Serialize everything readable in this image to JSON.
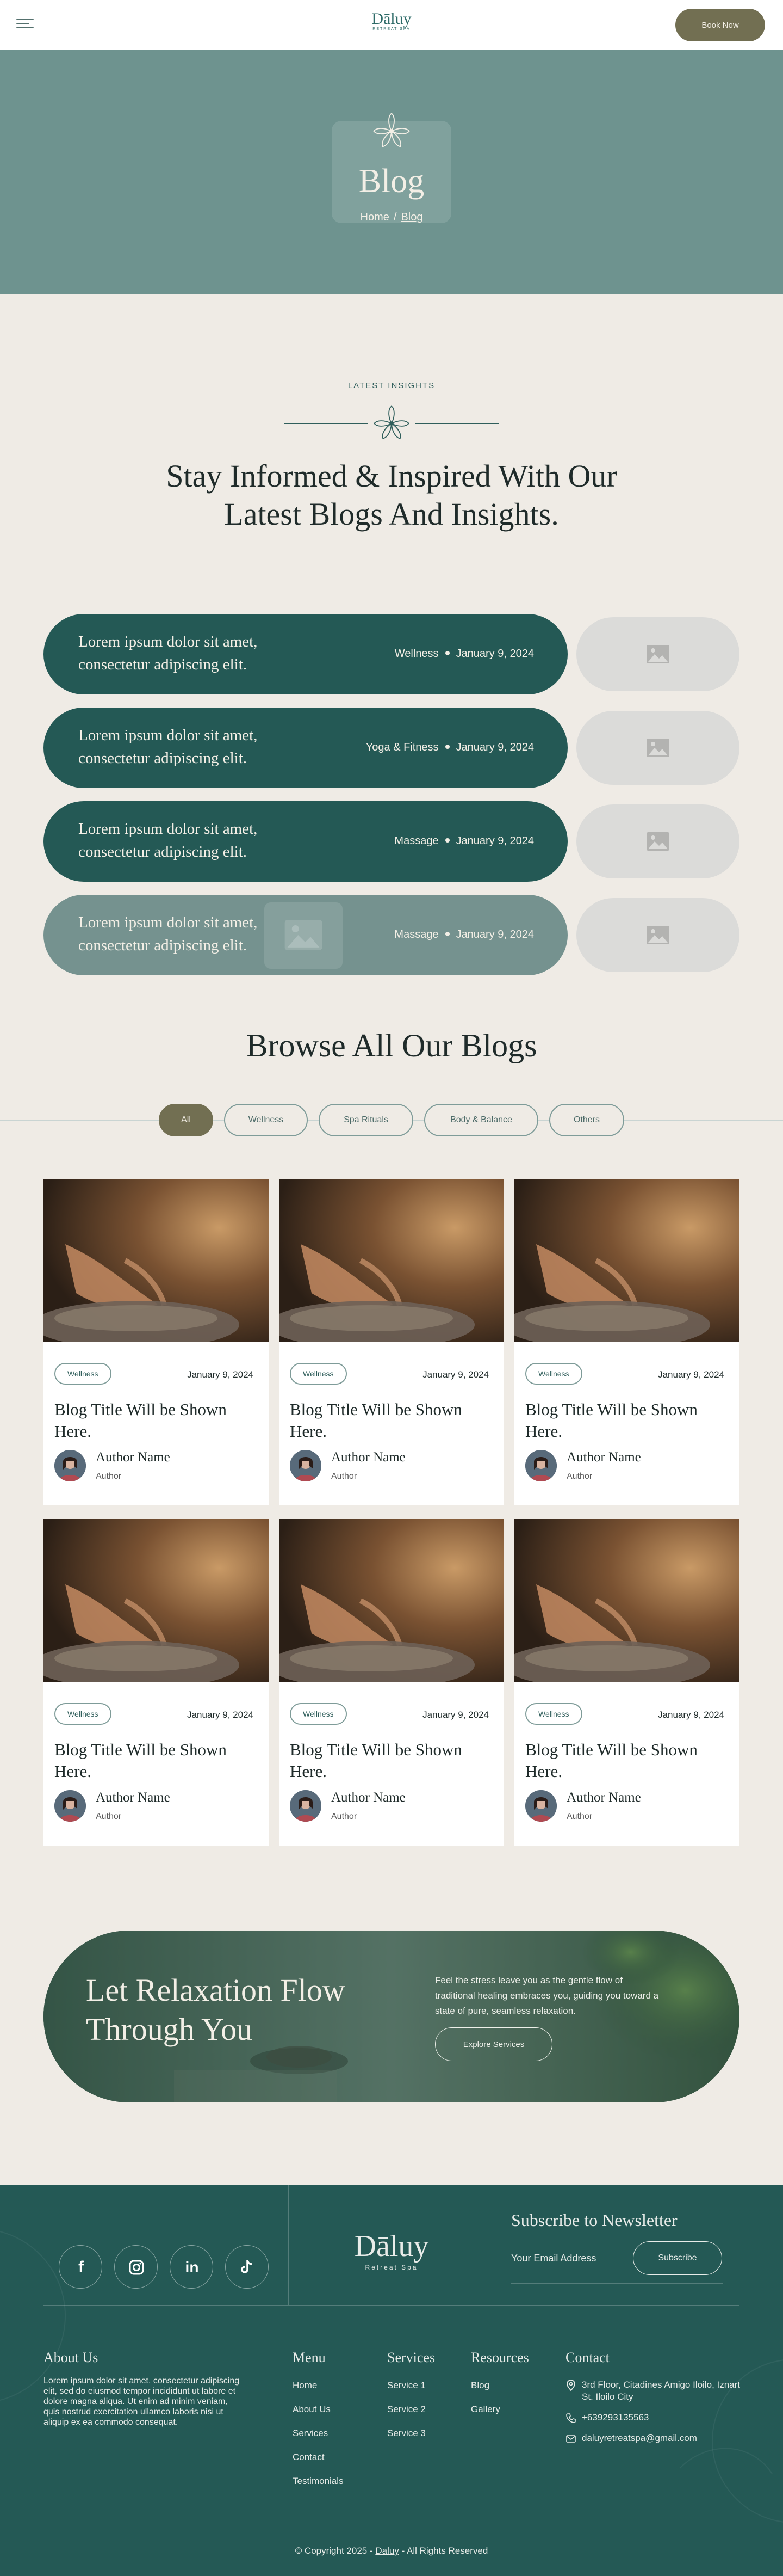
{
  "header": {
    "logo_name": "Dāluy",
    "logo_sub": "RETREAT SPA",
    "book_label": "Book Now"
  },
  "hero": {
    "title": "Blog",
    "crumb_home": "Home",
    "crumb_sep": "/",
    "crumb_current": "Blog"
  },
  "latest": {
    "eyebrow": "LATEST INSIGHTS",
    "title_line1": "Stay Informed & Inspired With Our",
    "title_line2": "Latest Blogs And Insights.",
    "items": [
      {
        "title": "Lorem ipsum dolor sit amet, consectetur adipiscing elit.",
        "category": "Wellness",
        "date": "January 9, 2024"
      },
      {
        "title": "Lorem ipsum dolor sit amet, consectetur adipiscing elit.",
        "category": "Yoga & Fitness",
        "date": "January 9, 2024"
      },
      {
        "title": "Lorem ipsum dolor sit amet, consectetur adipiscing elit.",
        "category": "Massage",
        "date": "January 9, 2024"
      },
      {
        "title": "Lorem ipsum dolor sit amet, consectetur adipiscing elit.",
        "category": "Massage",
        "date": "January 9, 2024"
      }
    ]
  },
  "browse": {
    "title": "Browse All Our Blogs",
    "filters": [
      "All",
      "Wellness",
      "Spa Rituals",
      "Body & Balance",
      "Others"
    ],
    "active_filter": "All",
    "cards": [
      {
        "tag": "Wellness",
        "date": "January 9, 2024",
        "title": "Blog Title Will be Shown Here.",
        "author": "Author Name",
        "role": "Author"
      },
      {
        "tag": "Wellness",
        "date": "January 9, 2024",
        "title": "Blog Title Will be Shown Here.",
        "author": "Author Name",
        "role": "Author"
      },
      {
        "tag": "Wellness",
        "date": "January 9, 2024",
        "title": "Blog Title Will be Shown Here.",
        "author": "Author Name",
        "role": "Author"
      },
      {
        "tag": "Wellness",
        "date": "January 9, 2024",
        "title": "Blog Title Will be Shown Here.",
        "author": "Author Name",
        "role": "Author"
      },
      {
        "tag": "Wellness",
        "date": "January 9, 2024",
        "title": "Blog Title Will be Shown Here.",
        "author": "Author Name",
        "role": "Author"
      },
      {
        "tag": "Wellness",
        "date": "January 9, 2024",
        "title": "Blog Title Will be Shown Here.",
        "author": "Author Name",
        "role": "Author"
      }
    ]
  },
  "cta": {
    "title_line1": "Let Relaxation Flow",
    "title_line2": "Through You",
    "text": "Feel the stress leave you as the gentle flow of traditional healing embraces you, guiding you toward a state of pure, seamless relaxation.",
    "button": "Explore Services"
  },
  "footer": {
    "social": [
      "facebook-icon",
      "instagram-icon",
      "linkedin-icon",
      "tiktok-icon"
    ],
    "logo_name": "Dāluy",
    "logo_sub": "Retreat Spa",
    "newsletter_title": "Subscribe to Newsletter",
    "newsletter_placeholder": "Your Email Address",
    "subscribe_label": "Subscribe",
    "about_title": "About Us",
    "about_text": "Lorem ipsum dolor sit amet, consectetur adipiscing elit, sed do eiusmod tempor incididunt ut labore et dolore magna aliqua. Ut enim ad minim veniam, quis nostrud exercitation ullamco laboris nisi ut aliquip ex ea commodo consequat.",
    "menu_title": "Menu",
    "menu": [
      "Home",
      "About Us",
      "Services",
      "Contact",
      "Testimonials"
    ],
    "services_title": "Services",
    "services": [
      "Service 1",
      "Service 2",
      "Service 3"
    ],
    "resources_title": "Resources",
    "resources": [
      "Blog",
      "Gallery"
    ],
    "contact_title": "Contact",
    "address": "3rd Floor, Citadines Amigo Iloilo, Iznart St. Iloilo City",
    "phone": "+639293135563",
    "email": "daluyretreatspa@gmail.com",
    "copyright_prefix": "© Copyright 2025 -",
    "copyright_brand": "Daluy",
    "copyright_suffix": "- All Rights Reserved"
  },
  "colors": {
    "primary_teal": "#245955",
    "hero_teal": "#6e938f",
    "accent_olive": "#726f52",
    "background": "#efebe5"
  }
}
